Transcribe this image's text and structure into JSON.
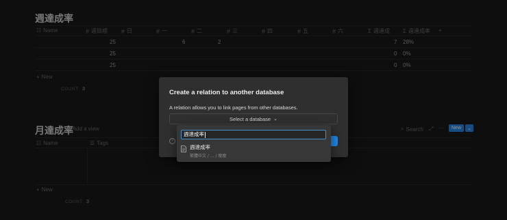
{
  "db1": {
    "title": "週達成率",
    "columns": [
      "Name",
      "週目標",
      "日",
      "一",
      "二",
      "三",
      "四",
      "五",
      "六",
      "週達成",
      "週達成率",
      "+"
    ],
    "rows": [
      {
        "target": "25",
        "mon": "6",
        "tue": "2",
        "achieved": "7",
        "rate": "28%"
      },
      {
        "target": "25",
        "mon": "",
        "tue": "",
        "achieved": "0",
        "rate": "0%"
      },
      {
        "target": "25",
        "mon": "",
        "tue": "",
        "achieved": "0",
        "rate": "0%"
      }
    ],
    "new_label": "New",
    "count_label": "COUNT",
    "count_value": "3"
  },
  "db2": {
    "title": "月達成率",
    "add_view": "Add a view",
    "columns": [
      "Name",
      "Tags"
    ],
    "new_label": "New",
    "count_label": "COUNT",
    "count_value": "3",
    "search_label": "Search",
    "new_button": "New"
  },
  "modal": {
    "title": "Create a relation to another database",
    "description": "A relation allows you to link pages from other databases.",
    "select_label": "Select a database",
    "accent_color": "#2383e2"
  },
  "dropdown": {
    "search_value": "週達成率",
    "result_title": "週達成率",
    "result_path": "繁體中文 / ... / 瘦瘦"
  }
}
